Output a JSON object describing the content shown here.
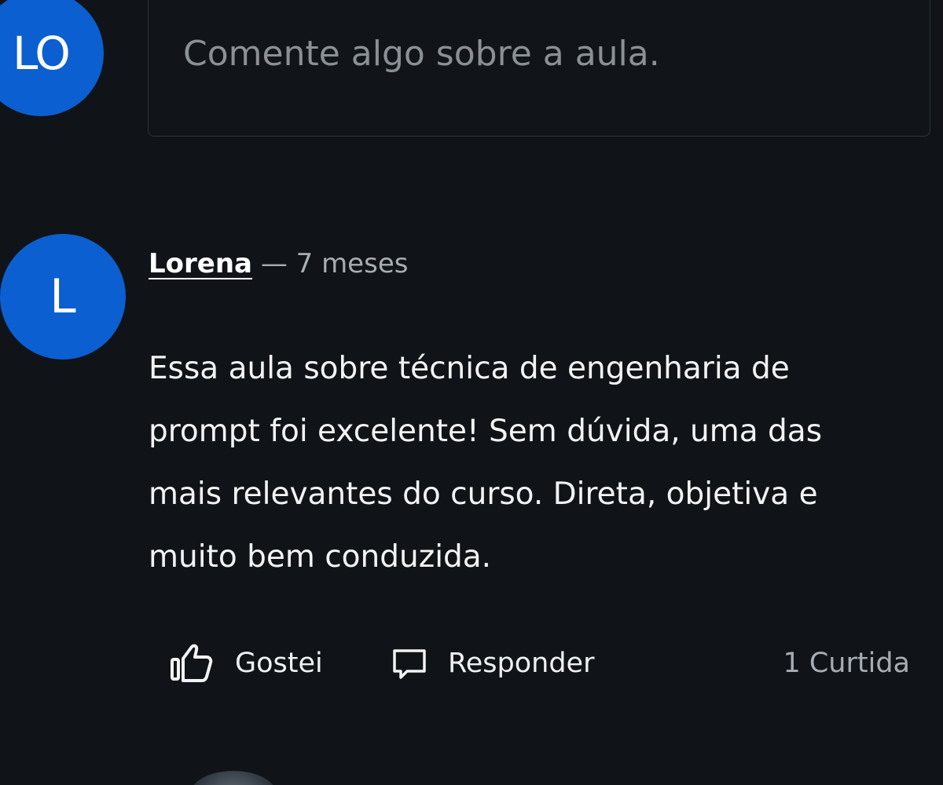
{
  "composer": {
    "avatar_initials": "LO",
    "placeholder": "Comente algo sobre a aula."
  },
  "comment": {
    "avatar_initial": "L",
    "author": "Lorena",
    "separator": "—",
    "time": "7 meses",
    "text_lines": [
      "Essa aula sobre técnica de engenharia de",
      "prompt foi excelente! Sem dúvida, uma das",
      "mais relevantes do curso. Direta, objetiva e",
      "muito bem conduzida."
    ]
  },
  "actions": {
    "like_label": "Gostei",
    "like_icon": "thumbs-up-icon",
    "reply_label": "Responder",
    "reply_icon": "speech-bubble-icon",
    "likes_count": "1 Curtida"
  },
  "colors": {
    "background": "#101418",
    "avatar_blue": "#0b5fd0",
    "muted_text": "#a7adb3"
  }
}
